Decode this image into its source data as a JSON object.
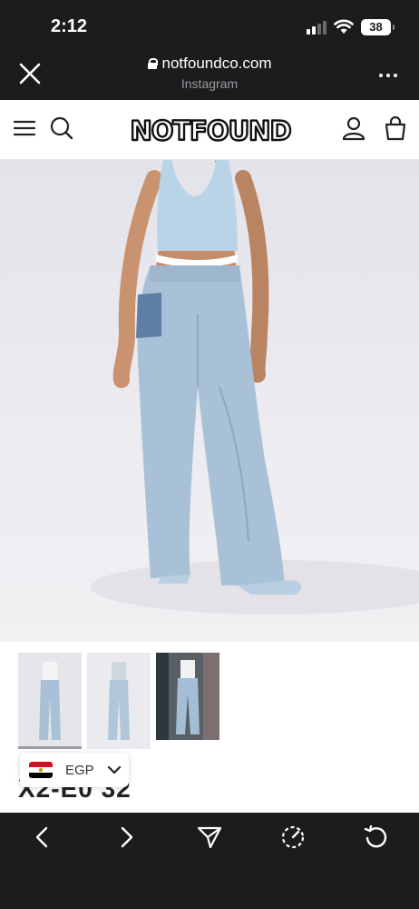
{
  "status_bar": {
    "time": "2:12",
    "battery": "38"
  },
  "browser": {
    "url": "notfoundco.com",
    "source": "Instagram"
  },
  "site": {
    "logo_text": "NOTFOUND"
  },
  "product": {
    "title_partial": "X2-E0 32",
    "thumbnails": [
      "front-view",
      "back-view",
      "street-view"
    ]
  },
  "currency": {
    "code": "EGP",
    "flag": "egypt-flag"
  },
  "toolbar": {
    "icons": [
      "back-icon",
      "forward-icon",
      "share-icon",
      "speed-icon",
      "reload-icon"
    ]
  },
  "colors": {
    "chrome": "#1c1c1e",
    "denim": "#a9c1d6",
    "top": "#b8d4e6"
  }
}
